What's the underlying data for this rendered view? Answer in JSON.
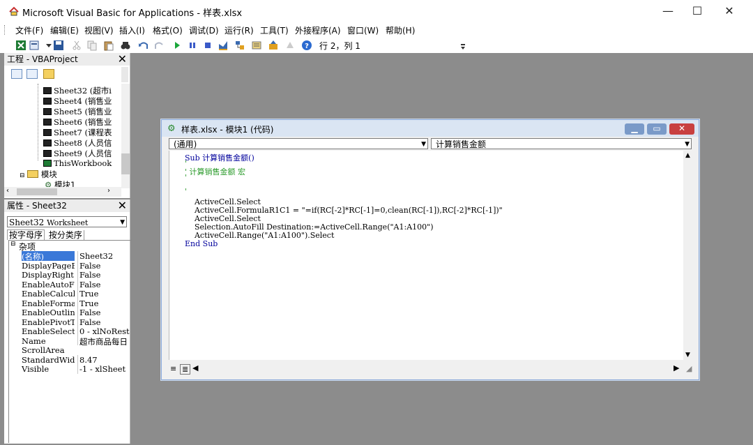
{
  "window": {
    "title": "Microsoft Visual Basic for Applications - 样表.xlsx"
  },
  "menu": [
    "文件(F)",
    "编辑(E)",
    "视图(V)",
    "插入(I)",
    "格式(O)",
    "调试(D)",
    "运行(R)",
    "工具(T)",
    "外接程序(A)",
    "窗口(W)",
    "帮助(H)"
  ],
  "toolbar": {
    "position": "行 2，列 1"
  },
  "project": {
    "title": "工程 - VBAProject",
    "items": [
      "Sheet32 (超市i",
      "Sheet4 (销售业",
      "Sheet5 (销售业",
      "Sheet6 (销售业",
      "Sheet7 (课程表",
      "Sheet8 (人员信",
      "Sheet9 (人员信",
      "ThisWorkbook"
    ],
    "folder": "模块",
    "module": "模块1"
  },
  "properties": {
    "title": "属性 - Sheet32",
    "object": "Sheet32",
    "object_type": "Worksheet",
    "tab_alpha": "按字母序",
    "tab_cat": "按分类序",
    "category": "杂项",
    "rows": [
      {
        "name": "(名称)",
        "value": "Sheet32"
      },
      {
        "name": "DisplayPageB",
        "value": "False"
      },
      {
        "name": "DisplayRight",
        "value": "False"
      },
      {
        "name": "EnableAutoFi",
        "value": "False"
      },
      {
        "name": "EnableCalcul",
        "value": "True"
      },
      {
        "name": "EnableFormat",
        "value": "True"
      },
      {
        "name": "EnableOutlin",
        "value": "False"
      },
      {
        "name": "EnablePivotT",
        "value": "False"
      },
      {
        "name": "EnableSelect",
        "value": "0 - xlNoRest"
      },
      {
        "name": "Name",
        "value": "超市商品每日"
      },
      {
        "name": "ScrollArea",
        "value": ""
      },
      {
        "name": "StandardWidt",
        "value": "8.47"
      },
      {
        "name": "Visible",
        "value": "-1 - xlSheet"
      }
    ]
  },
  "code_window": {
    "title": "样表.xlsx - 模块1 (代码)",
    "object_combo": "(通用)",
    "proc_combo": "计算销售金额",
    "lines": [
      {
        "text": "Sub 计算销售金额()",
        "type": "kw"
      },
      {
        "text": "'",
        "type": "cm"
      },
      {
        "text": "' 计算销售金额 宏",
        "type": "cm"
      },
      {
        "text": "'",
        "type": "cm"
      },
      {
        "text": "",
        "type": "code"
      },
      {
        "text": "'",
        "type": "cm"
      },
      {
        "text": "    ActiveCell.Select",
        "type": "code"
      },
      {
        "text": "    ActiveCell.FormulaR1C1 = \"=if(RC[-2]*RC[-1]=0,clean(RC[-1]),RC[-2]*RC[-1])\"",
        "type": "code"
      },
      {
        "text": "    ActiveCell.Select",
        "type": "code"
      },
      {
        "text": "    Selection.AutoFill Destination:=ActiveCell.Range(\"A1:A100\")",
        "type": "code"
      },
      {
        "text": "    ActiveCell.Range(\"A1:A100\").Select",
        "type": "code"
      },
      {
        "text": "End Sub",
        "type": "kw"
      }
    ]
  }
}
